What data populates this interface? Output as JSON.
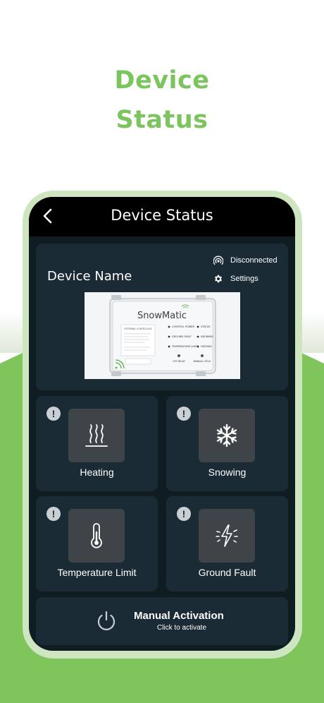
{
  "hero": {
    "line1": "Device",
    "line2": "Status"
  },
  "header": {
    "title": "Device Status",
    "back_icon": "chevron-left-icon"
  },
  "device": {
    "name": "Device Name",
    "connection": {
      "label": "Disconnected",
      "icon": "broadcast-icon"
    },
    "settings": {
      "label": "Settings",
      "icon": "gear-icon"
    },
    "image": {
      "brand": "SnowMatic",
      "panel_label": "EXTERNAL CONTROLLER",
      "left_labels": [
        "CONTROL POWER",
        "GROUND FAULT",
        "TEMPERATURE LIMIT",
        "OFF DELAY"
      ],
      "right_labels": [
        "STATUS",
        "SNOWING",
        "HEATING",
        "MANUAL CYCLE"
      ]
    }
  },
  "tiles": [
    {
      "label": "Heating",
      "icon": "heat-waves-icon",
      "badge": "!"
    },
    {
      "label": "Snowing",
      "icon": "snowflake-icon",
      "badge": "!"
    },
    {
      "label": "Temperature Limit",
      "icon": "thermometer-icon",
      "badge": "!"
    },
    {
      "label": "Ground Fault",
      "icon": "lightning-icon",
      "badge": "!"
    }
  ],
  "manual": {
    "title": "Manual Activation",
    "subtitle": "Click to activate",
    "icon": "power-icon"
  },
  "colors": {
    "accent": "#7cc45e",
    "screen_bg": "#0f1c22",
    "card_bg": "#1b2b35",
    "icon_box": "#3e4447",
    "frame": "#cde6c0"
  }
}
